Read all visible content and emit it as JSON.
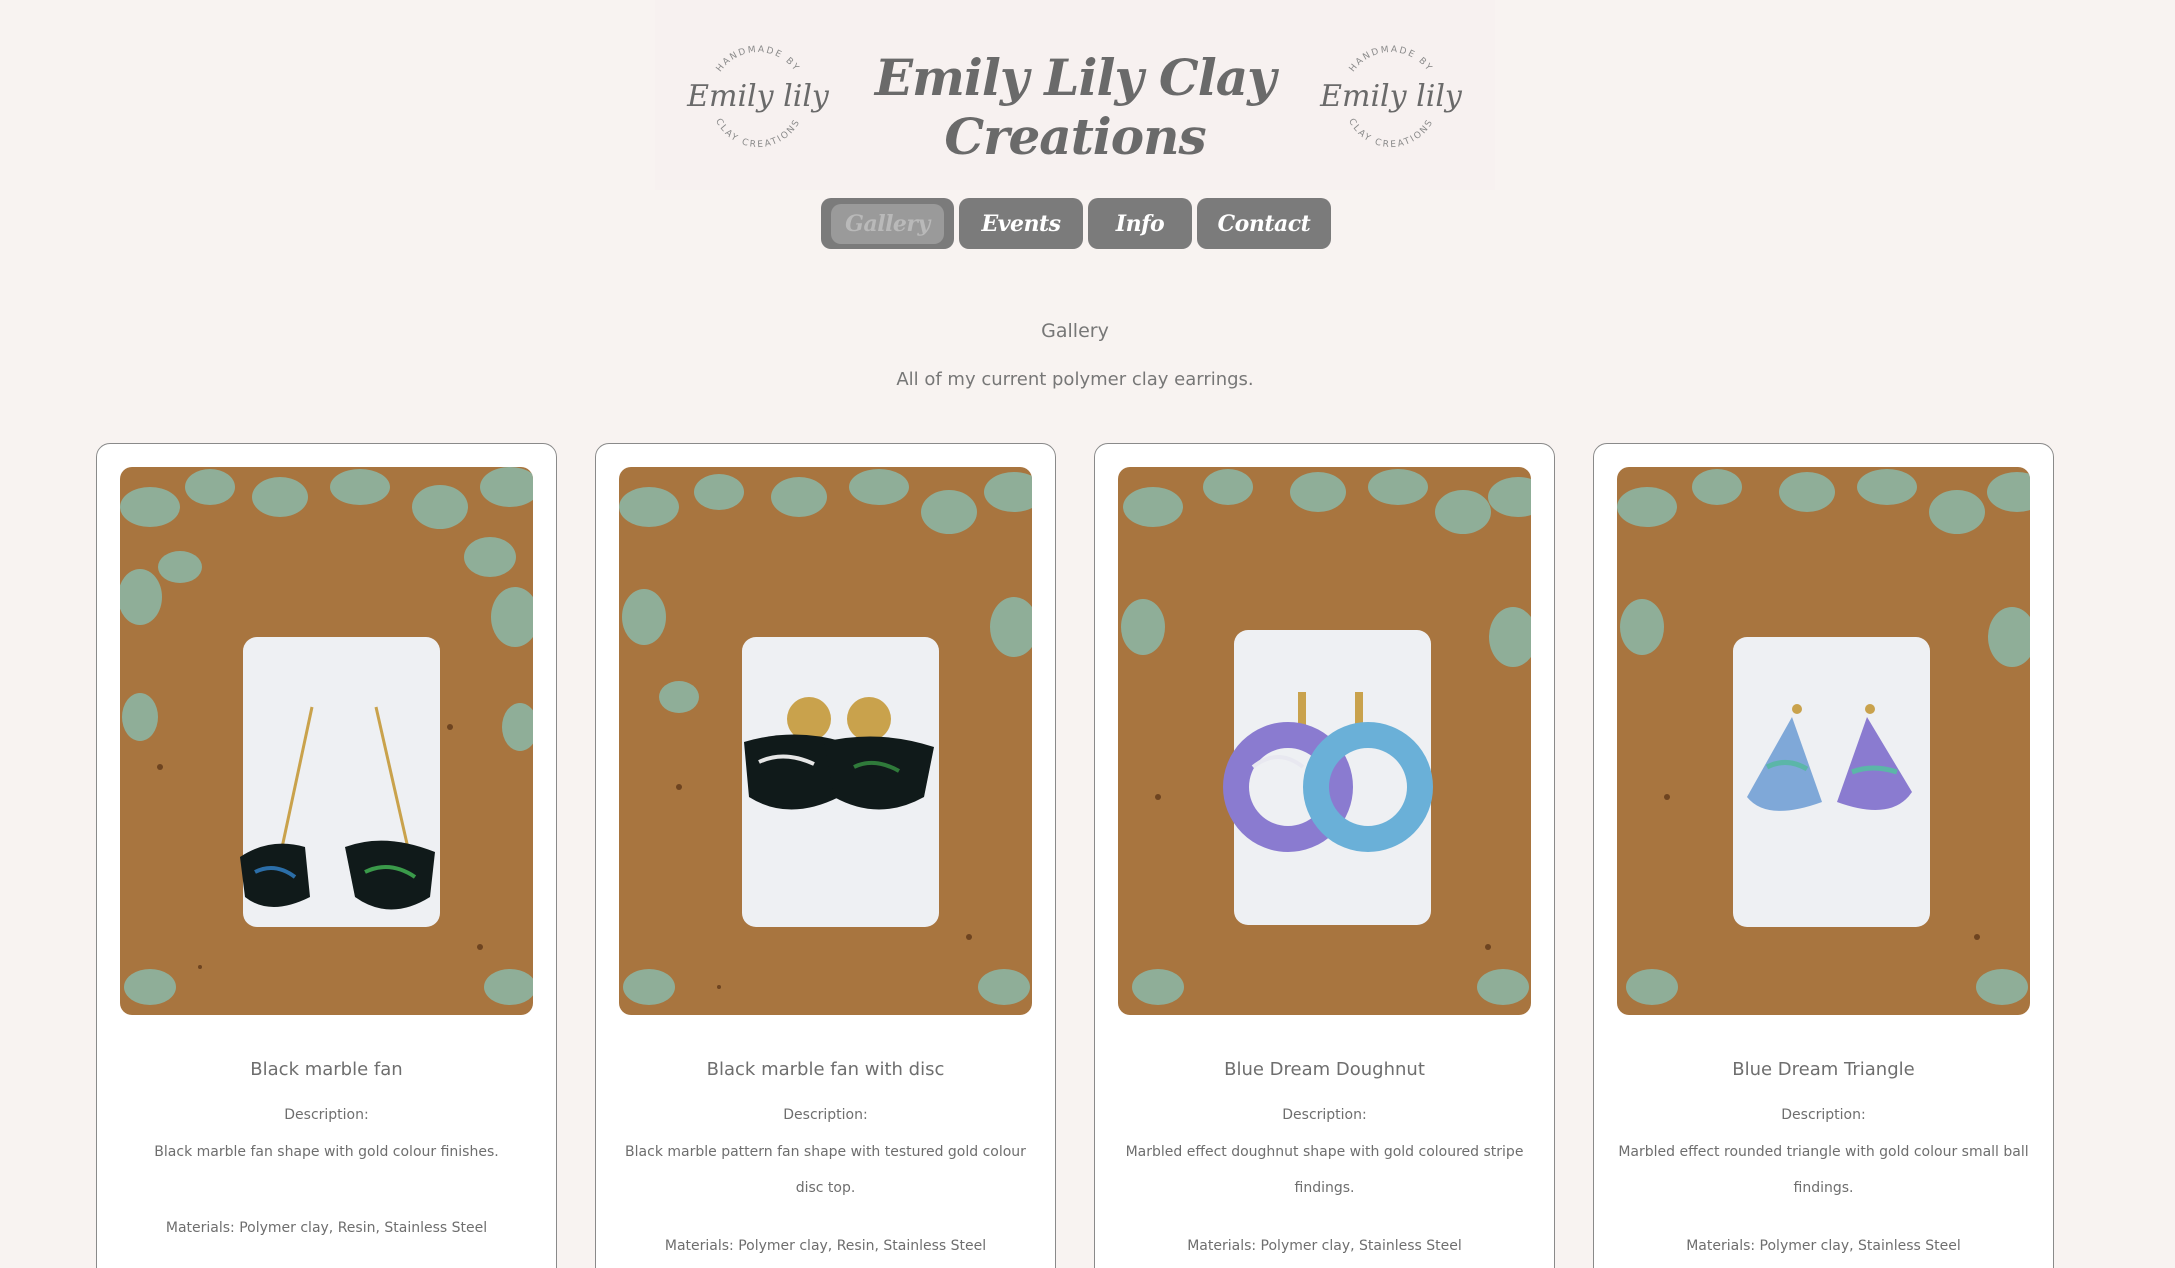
{
  "header": {
    "title": "Emily Lily Clay Creations",
    "logo_text": {
      "top": "HANDMADE BY",
      "script": "Emily lily",
      "bottom": "CLAY CREATIONS"
    }
  },
  "nav": {
    "items": [
      {
        "label": "Gallery",
        "active": true
      },
      {
        "label": "Events",
        "active": false
      },
      {
        "label": "Info",
        "active": false
      },
      {
        "label": "Contact",
        "active": false
      }
    ]
  },
  "gallery": {
    "title": "Gallery",
    "subtitle": "All of my current polymer clay earrings.",
    "items": [
      {
        "name": "Black marble fan",
        "description_label": "Description:",
        "description": "Black marble fan shape with gold colour finishes.",
        "materials": "Materials: Polymer clay, Resin, Stainless Steel"
      },
      {
        "name": "Black marble fan with disc",
        "description_label": "Description:",
        "description": "Black marble pattern fan shape with testured gold colour disc top.",
        "materials": "Materials: Polymer clay, Resin, Stainless Steel"
      },
      {
        "name": "Blue Dream Doughnut",
        "description_label": "Description:",
        "description": "Marbled effect doughnut shape with gold coloured stripe findings.",
        "materials": "Materials: Polymer clay, Stainless Steel"
      },
      {
        "name": "Blue Dream Triangle",
        "description_label": "Description:",
        "description": "Marbled effect rounded triangle with gold colour small ball findings.",
        "materials": "Materials: Polymer clay, Stainless Steel"
      }
    ]
  },
  "colors": {
    "background": "#f8f3f1",
    "nav_button": "#7b7b7b",
    "text": "#6e6e6e",
    "cork": "#a8753f",
    "leaf": "#8fae98"
  }
}
